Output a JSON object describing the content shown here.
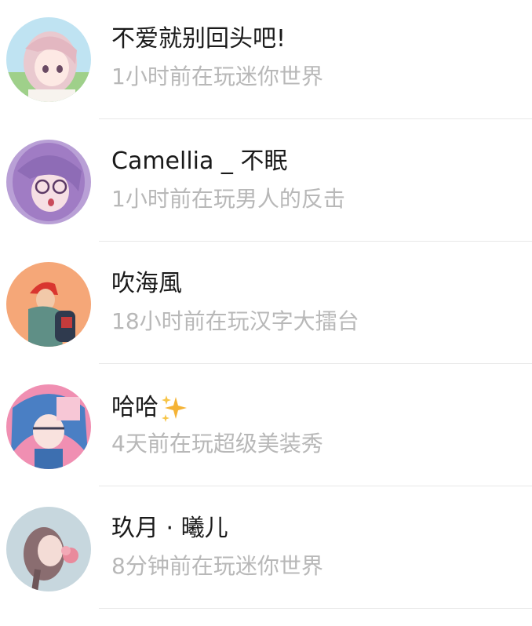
{
  "friends": [
    {
      "name": "不爱就别回头吧!",
      "status": "1小时前在玩迷你世界"
    },
    {
      "name": "Camellia _ 不眠",
      "status": "1小时前在玩男人的反击"
    },
    {
      "name": "吹海風",
      "status": "18小时前在玩汉字大擂台"
    },
    {
      "name": "哈哈",
      "status": "4天前在玩超级美装秀",
      "emoji": "sparkles-icon"
    },
    {
      "name": "玖月 · 曦儿",
      "status": "8分钟前在玩迷你世界"
    }
  ],
  "colors": {
    "name_text": "#1a1a1a",
    "status_text": "#b8b8b8",
    "divider": "#e8e8e8",
    "sparkle": "#f5b335"
  }
}
